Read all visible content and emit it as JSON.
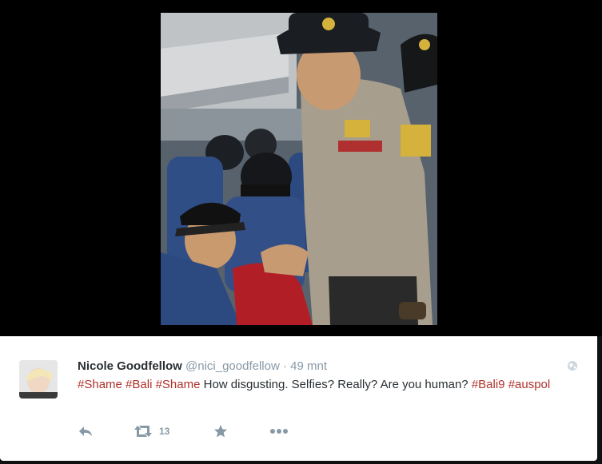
{
  "tweet": {
    "author_name": "Nicole Goodfellow",
    "author_handle": "@nici_goodfellow",
    "separator": "·",
    "timestamp": "49 mnt",
    "text_parts": [
      {
        "type": "hashtag",
        "text": "#Shame"
      },
      {
        "type": "text",
        "text": " "
      },
      {
        "type": "hashtag",
        "text": "#Bali"
      },
      {
        "type": "text",
        "text": " "
      },
      {
        "type": "hashtag",
        "text": "#Shame"
      },
      {
        "type": "text",
        "text": " How disgusting. Selfies? Really? Are you human? "
      },
      {
        "type": "hashtag",
        "text": "#Bali9"
      },
      {
        "type": "text",
        "text": " "
      },
      {
        "type": "hashtag",
        "text": "#auspol"
      }
    ],
    "retweet_count": "13"
  },
  "icons": {
    "photo": "embedded-photo",
    "avatar": "user-avatar",
    "globe": "globe-icon",
    "reply": "reply-icon",
    "retweet": "retweet-icon",
    "favorite": "star-icon",
    "more": "more-dots-icon"
  },
  "colors": {
    "hashtag": "#b0302b",
    "name": "#292f33",
    "muted": "#8899a6",
    "background": "#000000"
  }
}
